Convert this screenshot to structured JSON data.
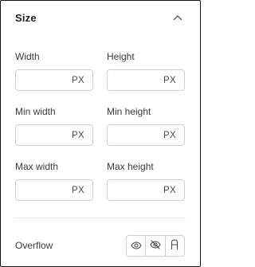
{
  "section": {
    "title": "Size",
    "collapse_icon": "chevron-up-icon"
  },
  "fields": {
    "width": {
      "label": "Width",
      "value": "",
      "unit": "PX"
    },
    "height": {
      "label": "Height",
      "value": "",
      "unit": "PX"
    },
    "min_width": {
      "label": "Min width",
      "value": "",
      "unit": "PX"
    },
    "min_height": {
      "label": "Min height",
      "value": "",
      "unit": "PX"
    },
    "max_width": {
      "label": "Max width",
      "value": "",
      "unit": "PX"
    },
    "max_height": {
      "label": "Max height",
      "value": "",
      "unit": "PX"
    }
  },
  "overflow": {
    "label": "Overflow",
    "options": [
      {
        "icon": "eye-icon"
      },
      {
        "icon": "eye-off-icon"
      },
      {
        "icon": "auto-icon",
        "glyph": "A"
      }
    ]
  }
}
